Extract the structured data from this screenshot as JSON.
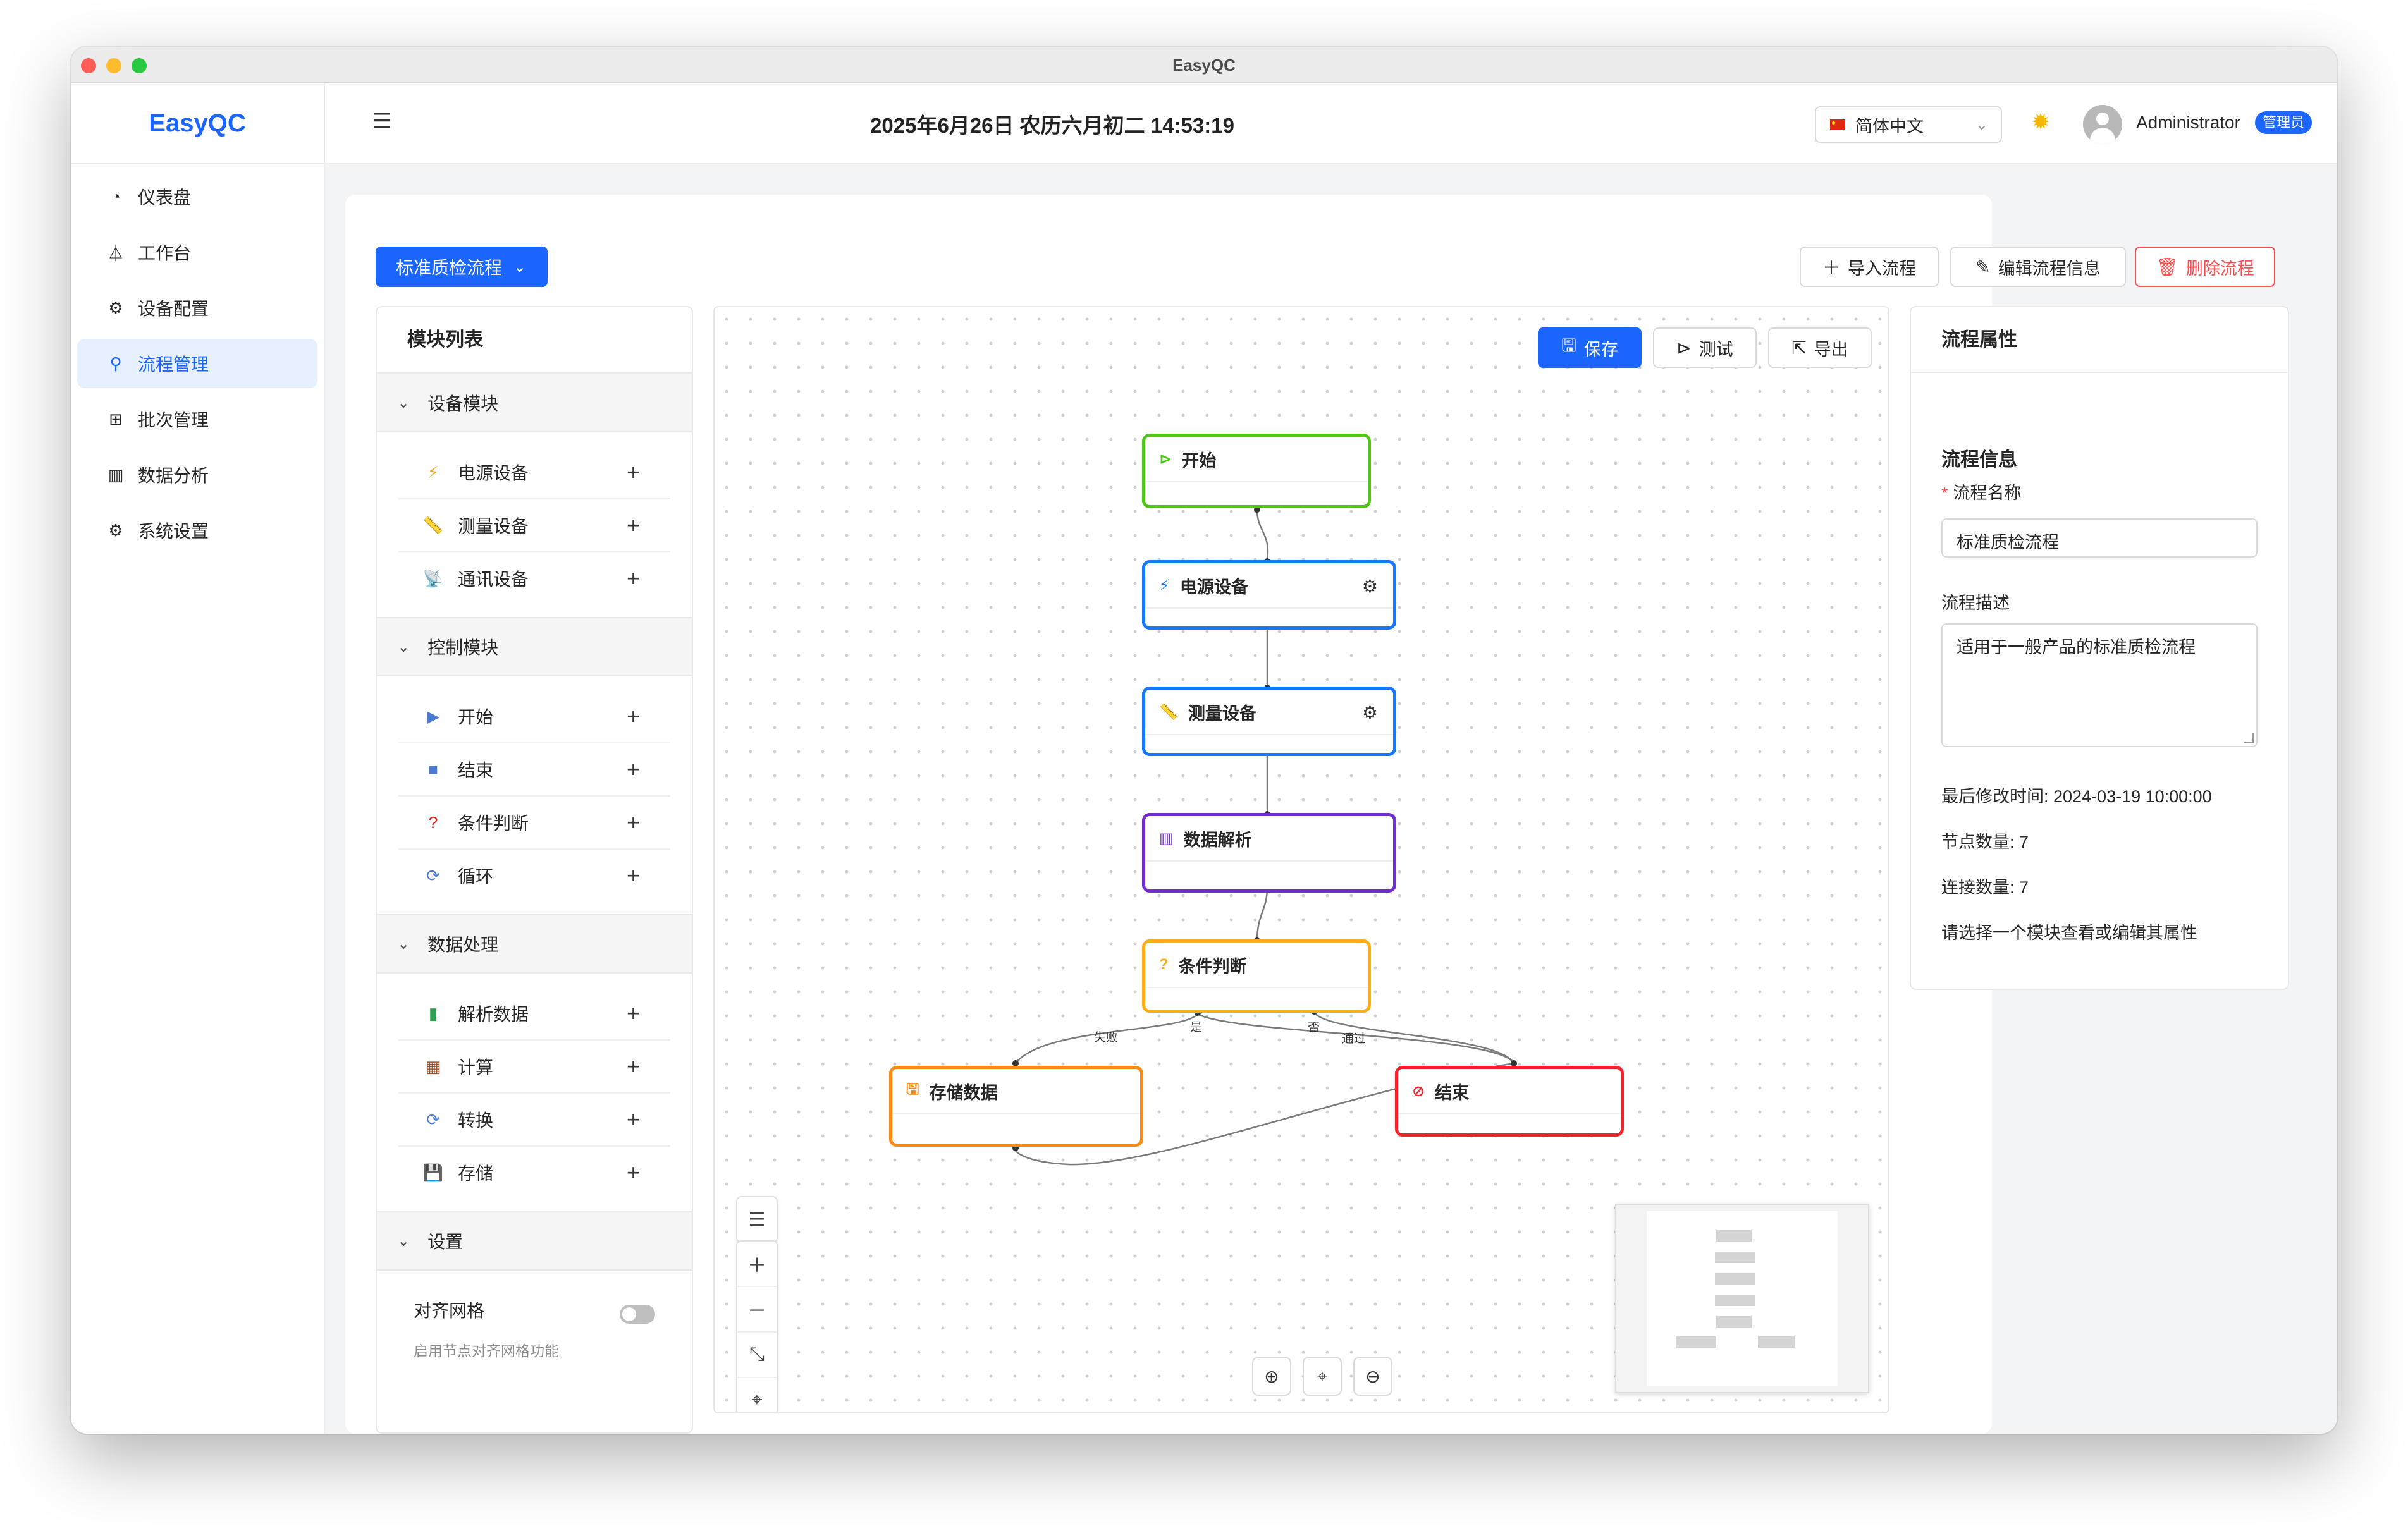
{
  "window": {
    "title": "EasyQC"
  },
  "sidebar": {
    "brand": "EasyQC",
    "items": [
      {
        "label": "仪表盘",
        "icon": "gauge-icon",
        "glyph": "◔"
      },
      {
        "label": "工作台",
        "icon": "flask-icon",
        "glyph": "⏃"
      },
      {
        "label": "设备配置",
        "icon": "gear-icon",
        "glyph": "⚙"
      },
      {
        "label": "流程管理",
        "icon": "flow-icon",
        "glyph": "⚲",
        "active": true
      },
      {
        "label": "批次管理",
        "icon": "grid-icon",
        "glyph": "⊞"
      },
      {
        "label": "数据分析",
        "icon": "bar-chart-icon",
        "glyph": "▥"
      },
      {
        "label": "系统设置",
        "icon": "settings-icon",
        "glyph": "⚙"
      }
    ]
  },
  "header": {
    "datetime": "2025年6月26日 农历六月初二 14:53:19",
    "language": "简体中文",
    "user": "Administrator",
    "role": "管理员"
  },
  "toolbar": {
    "flow_select": "标准质检流程",
    "import": "导入流程",
    "edit": "编辑流程信息",
    "delete": "删除流程"
  },
  "module_list": {
    "title": "模块列表",
    "sections": [
      {
        "title": "设备模块",
        "items": [
          {
            "label": "电源设备",
            "icon": "lightning-icon",
            "glyph": "⚡",
            "color": "#f5a623"
          },
          {
            "label": "测量设备",
            "icon": "ruler-icon",
            "glyph": "📏",
            "color": "#8c8c8c"
          },
          {
            "label": "通讯设备",
            "icon": "antenna-icon",
            "glyph": "📡",
            "color": "#8c8c8c"
          }
        ]
      },
      {
        "title": "控制模块",
        "items": [
          {
            "label": "开始",
            "icon": "play-icon",
            "glyph": "▶",
            "color": "#4a7bd0"
          },
          {
            "label": "结束",
            "icon": "stop-icon",
            "glyph": "■",
            "color": "#4a7bd0"
          },
          {
            "label": "条件判断",
            "icon": "question-icon",
            "glyph": "?",
            "color": "#e02020"
          },
          {
            "label": "循环",
            "icon": "loop-icon",
            "glyph": "⟳",
            "color": "#4a7bd0"
          }
        ]
      },
      {
        "title": "数据处理",
        "items": [
          {
            "label": "解析数据",
            "icon": "chart-icon",
            "glyph": "▮",
            "color": "#2e9e4f"
          },
          {
            "label": "计算",
            "icon": "abacus-icon",
            "glyph": "▦",
            "color": "#a0522d"
          },
          {
            "label": "转换",
            "icon": "convert-icon",
            "glyph": "⟳",
            "color": "#4a7bd0"
          },
          {
            "label": "存储",
            "icon": "floppy-icon",
            "glyph": "💾",
            "color": "#555555"
          }
        ]
      }
    ],
    "settings": {
      "title": "设置",
      "snap_label": "对齐网格",
      "snap_desc": "启用节点对齐网格功能"
    }
  },
  "canvas": {
    "save": "保存",
    "test": "测试",
    "export": "导出",
    "nodes": [
      {
        "id": "start",
        "label": "开始",
        "icon": "play-circle-icon",
        "glyph": "⊳",
        "color": "#52c41a",
        "gear": false
      },
      {
        "id": "power",
        "label": "电源设备",
        "icon": "lightning-icon",
        "glyph": "⚡",
        "color": "#1677ff",
        "gear": true
      },
      {
        "id": "measure",
        "label": "测量设备",
        "icon": "ruler-icon",
        "glyph": "📏",
        "color": "#1677ff",
        "gear": true
      },
      {
        "id": "parse",
        "label": "数据解析",
        "icon": "chart-icon",
        "glyph": "▥",
        "color": "#722ed1",
        "gear": false
      },
      {
        "id": "cond",
        "label": "条件判断",
        "icon": "question-circle-icon",
        "glyph": "?",
        "color": "#faad14",
        "gear": false
      },
      {
        "id": "store",
        "label": "存储数据",
        "icon": "save-icon",
        "glyph": "🖫",
        "color": "#fa8c16",
        "gear": false
      },
      {
        "id": "end",
        "label": "结束",
        "icon": "stop-circle-icon",
        "glyph": "⊘",
        "color": "#f5222d",
        "gear": false
      }
    ],
    "edge_labels": {
      "fail": "失败",
      "yes": "是",
      "no": "否",
      "pass": "通过"
    }
  },
  "properties": {
    "title": "流程属性",
    "section": "流程信息",
    "name_label": "流程名称",
    "name_value": "标准质检流程",
    "desc_label": "流程描述",
    "desc_value": "适用于一般产品的标准质检流程",
    "modified": "最后修改时间: 2024-03-19 10:00:00",
    "node_count": "节点数量: 7",
    "edge_count": "连接数量: 7",
    "hint": "请选择一个模块查看或编辑其属性"
  }
}
